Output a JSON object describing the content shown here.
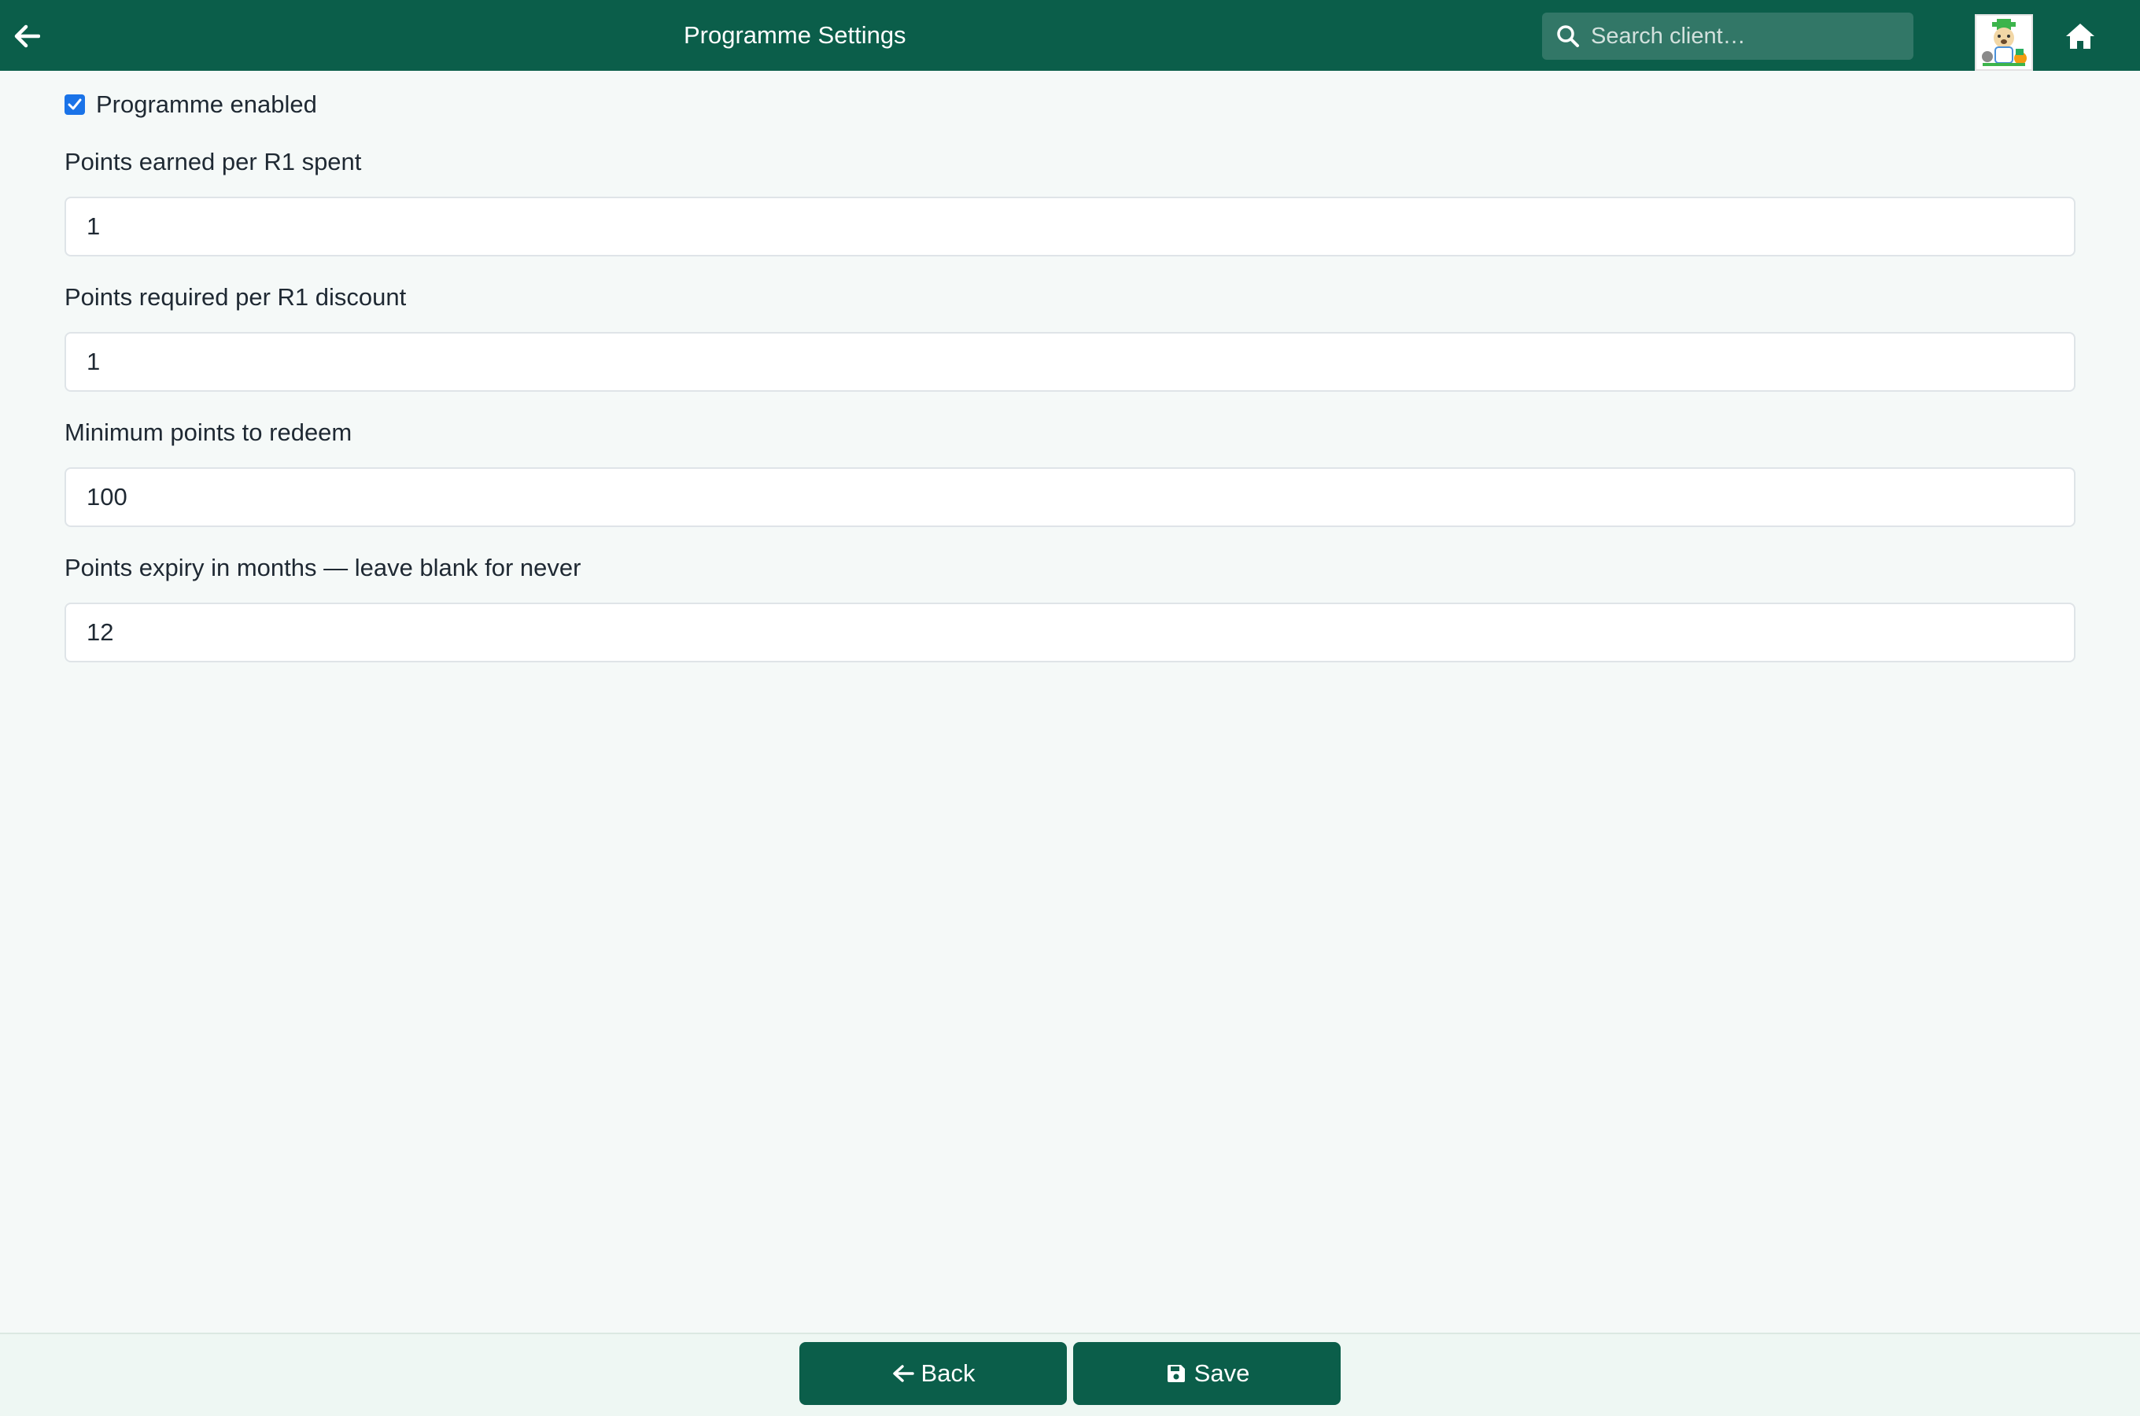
{
  "header": {
    "title": "Programme Settings",
    "back_icon": "arrow-left-icon",
    "search": {
      "placeholder": "Search client…",
      "value": "",
      "icon": "search-icon"
    },
    "logo": "clinic-logo",
    "home_icon": "home-icon",
    "color": "#0b5e4a"
  },
  "form": {
    "enabled": {
      "label": "Programme enabled",
      "checked": true,
      "color": "#1a73e8"
    },
    "fields": [
      {
        "label": "Points earned per R1 spent",
        "value": "1"
      },
      {
        "label": "Points required per R1 discount",
        "value": "1"
      },
      {
        "label": "Minimum points to redeem",
        "value": "100"
      },
      {
        "label": "Points expiry in months — leave blank for never",
        "value": "12"
      }
    ]
  },
  "footer": {
    "back_label": "Back",
    "back_icon": "arrow-left-icon",
    "save_label": "Save",
    "save_icon": "floppy-disk-icon"
  }
}
